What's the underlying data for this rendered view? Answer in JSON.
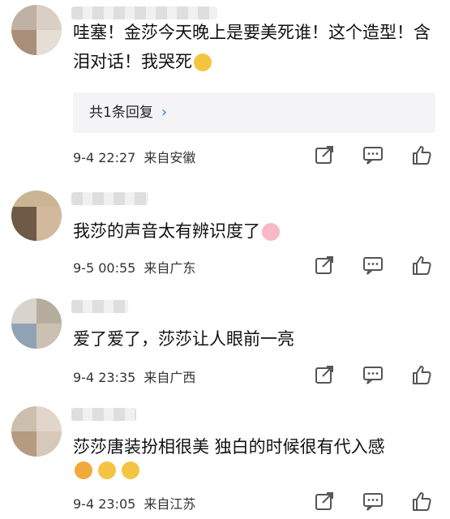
{
  "comments": [
    {
      "text": "哇塞！金莎今天晚上是要美死谁！这个造型！含泪对话！我哭死",
      "emoji_trailing": [
        "crying-face"
      ],
      "reply_label": "共1条回复",
      "reply_chevron": "›",
      "date": "9-4 22:27",
      "location": "来自安徽"
    },
    {
      "text": "我莎的声音太有辨识度了",
      "emoji_trailing": [
        "pig-face"
      ],
      "date": "9-5 00:55",
      "location": "来自广东"
    },
    {
      "text": "爱了爱了，莎莎让人眼前一亮",
      "date": "9-4 23:35",
      "location": "来自广西"
    },
    {
      "text": "莎莎唐装扮相很美 独白的时候很有代入感",
      "emoji_line": [
        "party-face",
        "heart-eyes-face",
        "heart-eyes-face"
      ],
      "date": "9-4 23:05",
      "location": "来自江苏"
    }
  ],
  "icons": {
    "share": "share-icon",
    "comment": "comment-icon",
    "like": "thumbs-up-icon"
  },
  "colors": {
    "accent": "#2c7be5",
    "reply_bg": "#f4f4f6"
  }
}
